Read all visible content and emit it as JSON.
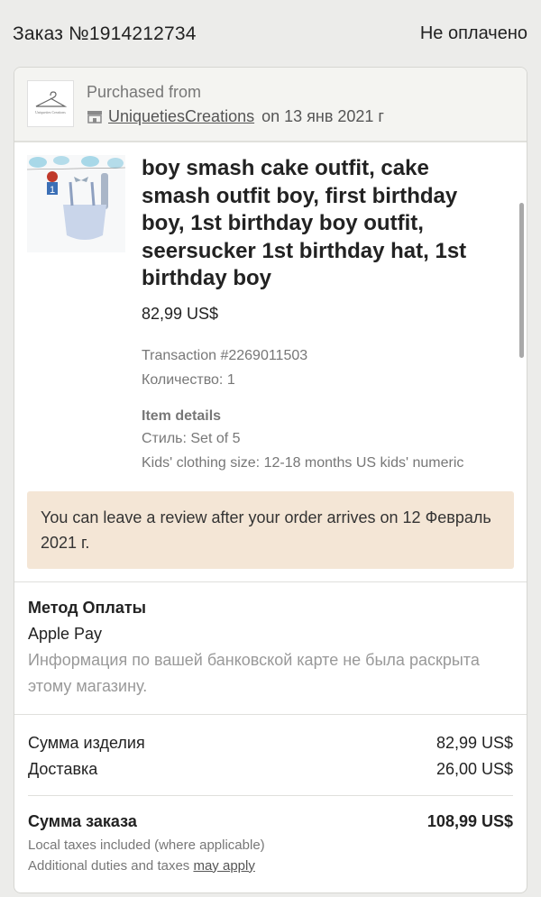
{
  "header": {
    "order_number": "Заказ №1914212734",
    "status": "Не оплачено"
  },
  "shop": {
    "purchased_from": "Purchased from",
    "name": "UniquetiesCreations",
    "date": "on 13 янв 2021 г",
    "logo_icon": "hanger-logo-icon",
    "store_icon": "store-icon"
  },
  "item": {
    "title": "boy smash cake outfit, cake smash outfit boy, first birthday boy, 1st birthday boy outfit, seersucker 1st birthday hat, 1st birthday boy",
    "price": "82,99 US$",
    "transaction": "Transaction #2269011503",
    "quantity": "Количество: 1",
    "details_heading": "Item details",
    "style": "Стиль: Set of 5",
    "size": "Kids' clothing size: 12-18 months US kids' numeric"
  },
  "review_notice": "You can leave a review after your order arrives on 12 Февраль 2021 г.",
  "payment": {
    "heading": "Метод Оплаты",
    "method": "Apple Pay",
    "note": "Информация по вашей банковской карте не была раскрыта этому магазину."
  },
  "summary": {
    "item_total_label": "Сумма изделия",
    "item_total_value": "82,99 US$",
    "shipping_label": "Доставка",
    "shipping_value": "26,00 US$",
    "order_total_label": "Сумма заказа",
    "order_total_value": "108,99 US$",
    "tax_note": "Local taxes included (where applicable)",
    "duties_note": "Additional duties and taxes",
    "duties_link": "may apply"
  },
  "colors": {
    "background": "#ececea",
    "review_box": "#f4e6d6"
  }
}
